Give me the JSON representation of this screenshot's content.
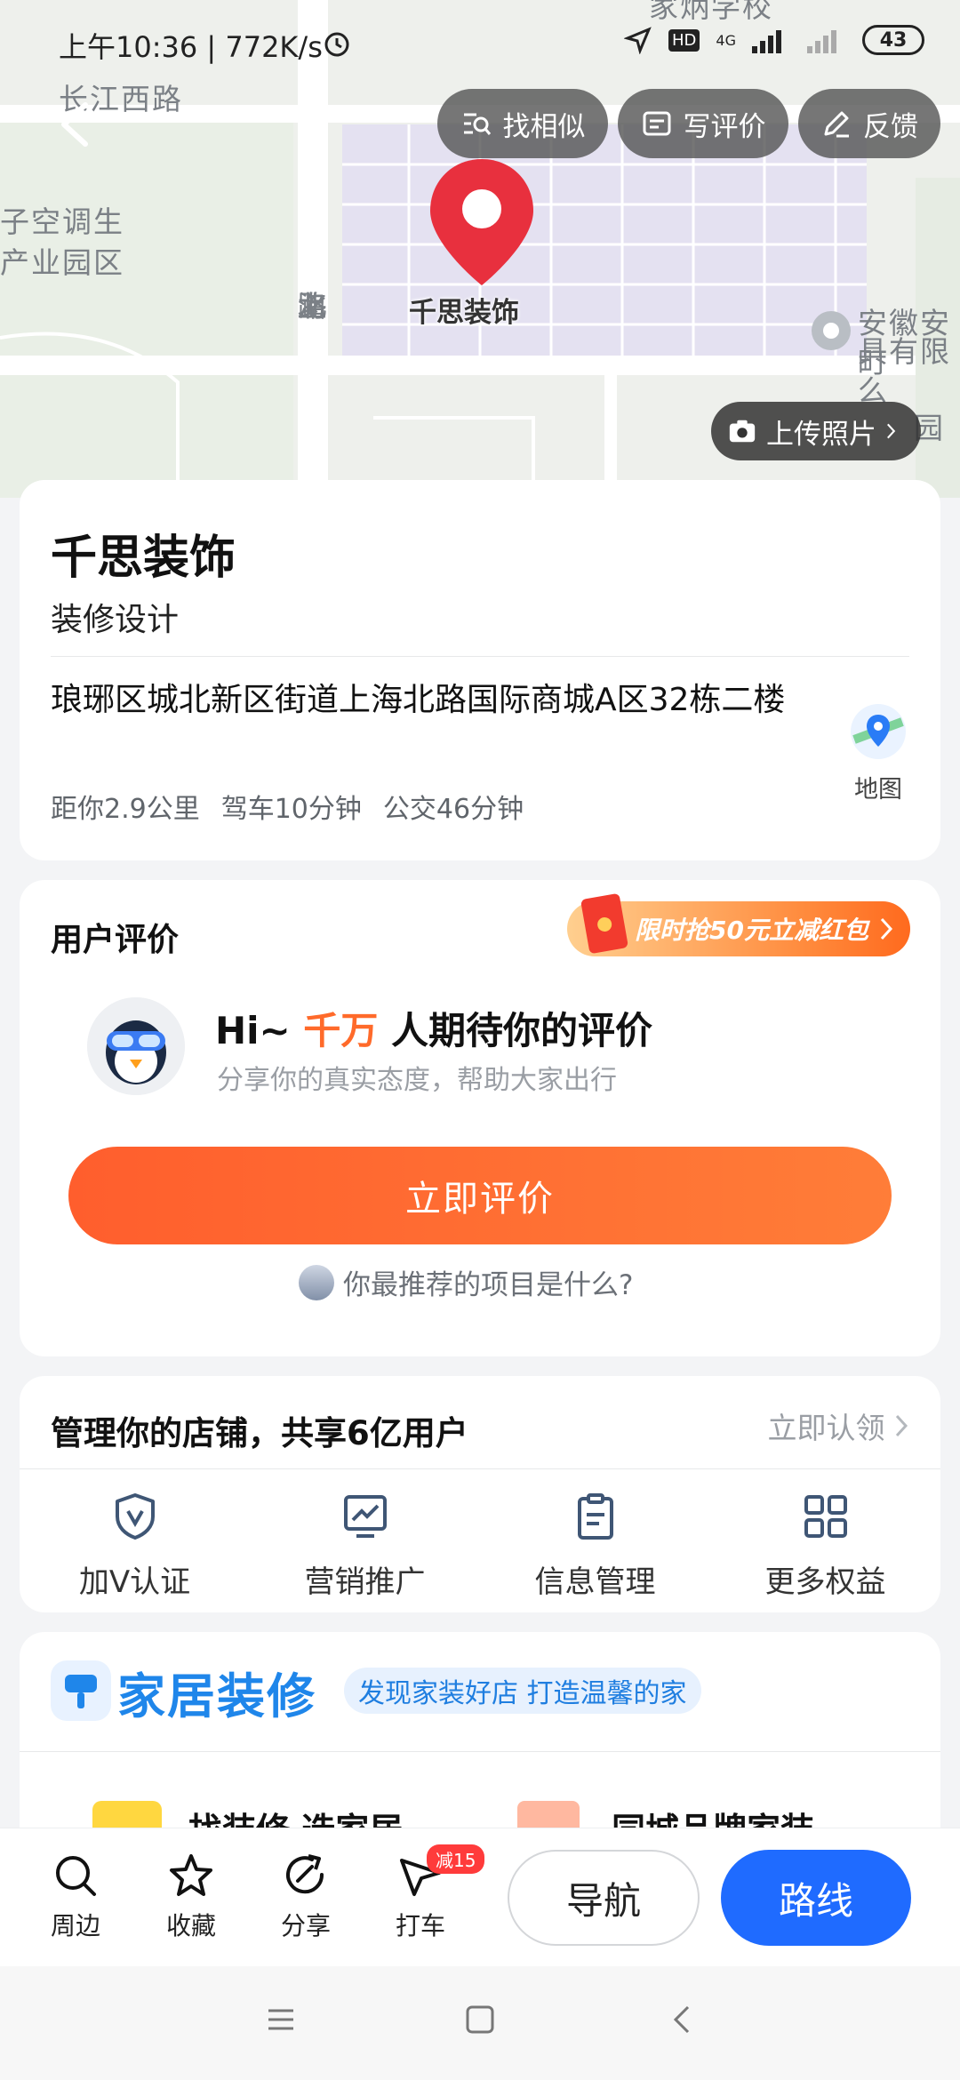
{
  "status_bar": {
    "time": "上午10:36 | 772K/s",
    "network": "4G",
    "hd": "HD",
    "battery": "43"
  },
  "map": {
    "labels": {
      "road_top": "长江西路",
      "area_left_line1": "子空调生",
      "area_left_line2": "产业园区",
      "road_vertical": [
        "上",
        "海",
        "北",
        "路"
      ],
      "poi_right_line1": "安徽安町",
      "poi_right_line2": "具有限么",
      "school_top": "家炳学校",
      "park_right": "园"
    },
    "pin_label": "千思装饰",
    "upload_label": "上传照片"
  },
  "top_actions": {
    "find_similar": "找相似",
    "write_review": "写评价",
    "feedback": "反馈"
  },
  "place": {
    "name": "千思装饰",
    "category": "装修设计",
    "address": "琅琊区城北新区街道上海北路国际商城A区32栋二楼",
    "distance": "距你2.9公里",
    "drive": "驾车10分钟",
    "bus": "公交46分钟",
    "map_label": "地图"
  },
  "review": {
    "title": "用户评价",
    "coupon": "限时抢50元立减红包",
    "hi_prefix": "Hi~",
    "hi_count": "千万",
    "hi_suffix": "人期待你的评价",
    "subtitle": "分享你的真实态度，帮助大家出行",
    "button": "立即评价",
    "question": "你最推荐的项目是什么?"
  },
  "manage": {
    "title": "管理你的店铺，共享6亿用户",
    "claim": "立即认领",
    "benefits": [
      {
        "label": "加V认证",
        "icon": "verified-shield-icon"
      },
      {
        "label": "营销推广",
        "icon": "trend-chart-icon"
      },
      {
        "label": "信息管理",
        "icon": "clipboard-icon"
      },
      {
        "label": "更多权益",
        "icon": "grid-icon"
      }
    ]
  },
  "deco": {
    "title": "家居装修",
    "tag": "发现家装好店 打造温馨的家",
    "peek_left": "找装修 选家居",
    "peek_right": "同城品牌家装"
  },
  "bottom_bar": {
    "nearby": "周边",
    "favorite": "收藏",
    "share": "分享",
    "taxi": "打车",
    "taxi_badge": "减15",
    "navigate": "导航",
    "route": "路线"
  },
  "colors": {
    "accent_orange": "#ff6a2a",
    "primary_blue": "#1f6bff",
    "pin_red": "#e8303e",
    "deco_blue": "#1f86ea"
  }
}
